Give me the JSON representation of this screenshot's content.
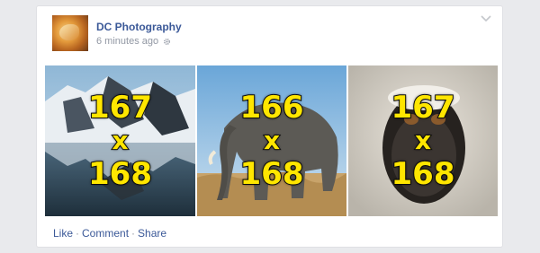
{
  "post": {
    "page_name": "DC Photography",
    "timestamp": "6 minutes ago",
    "privacy_icon": "gear-icon",
    "menu_icon": "chevron-down-icon"
  },
  "photos": [
    {
      "width_label": "167",
      "x_label": "x",
      "height_label": "168",
      "subject": "glacier-landscape"
    },
    {
      "width_label": "166",
      "x_label": "x",
      "height_label": "168",
      "subject": "elephant"
    },
    {
      "width_label": "167",
      "x_label": "x",
      "height_label": "168",
      "subject": "monkey"
    }
  ],
  "actions": {
    "like": "Like",
    "comment": "Comment",
    "share": "Share",
    "separator": "·"
  },
  "colors": {
    "link": "#3b5998",
    "meta": "#9197a3",
    "overlay_text": "#ffe600",
    "background": "#e9eaed"
  }
}
